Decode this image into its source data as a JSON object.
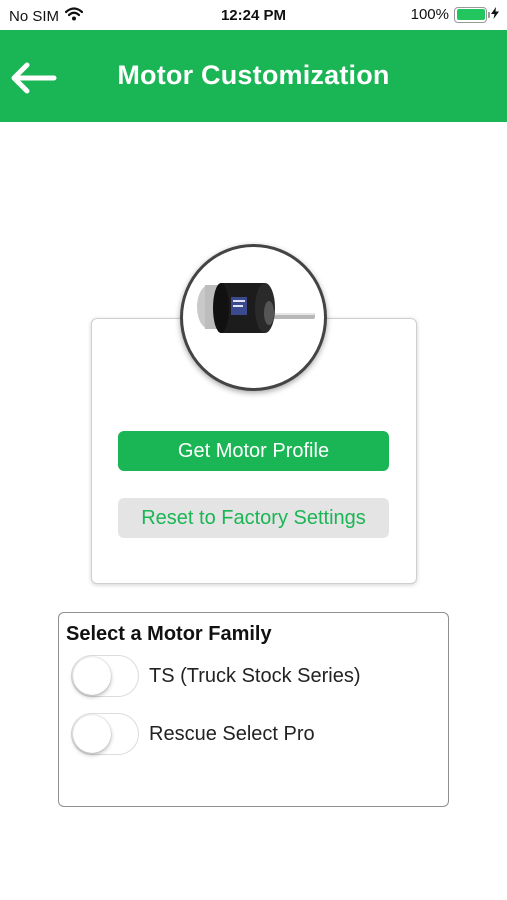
{
  "status_bar": {
    "carrier": "No SIM",
    "time": "12:24 PM",
    "battery_percent": "100%",
    "battery_level": 1.0,
    "icons": [
      "wifi-icon",
      "battery-icon",
      "charging-bolt-icon"
    ],
    "battery_color": "#22c55e"
  },
  "nav": {
    "title": "Motor Customization",
    "back_icon": "back-arrow-icon",
    "background_color": "#1ab554"
  },
  "motor_card": {
    "image": "motor-photo",
    "get_profile_label": "Get Motor Profile",
    "reset_label": "Reset to Factory Settings"
  },
  "motor_family": {
    "title": "Select a Motor Family",
    "options": [
      {
        "label": "TS (Truck Stock Series)",
        "enabled": false
      },
      {
        "label": "Rescue Select Pro",
        "enabled": false
      }
    ]
  }
}
